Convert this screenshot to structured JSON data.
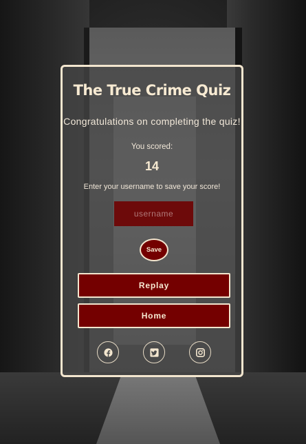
{
  "quiz": {
    "title": "The True Crime Quiz",
    "congrats": "Congratulations on completing the quiz!",
    "scored_label": "You scored:",
    "score": "14",
    "enter_label": "Enter your username to save your score!",
    "username_placeholder": "username",
    "username_value": "",
    "save_label": "Save",
    "replay_label": "Replay",
    "home_label": "Home"
  },
  "social": [
    {
      "icon": "facebook-icon"
    },
    {
      "icon": "twitter-icon"
    },
    {
      "icon": "instagram-icon"
    }
  ],
  "colors": {
    "accent": "#740000",
    "border": "#f3e6cf",
    "text": "#f7ead2"
  }
}
